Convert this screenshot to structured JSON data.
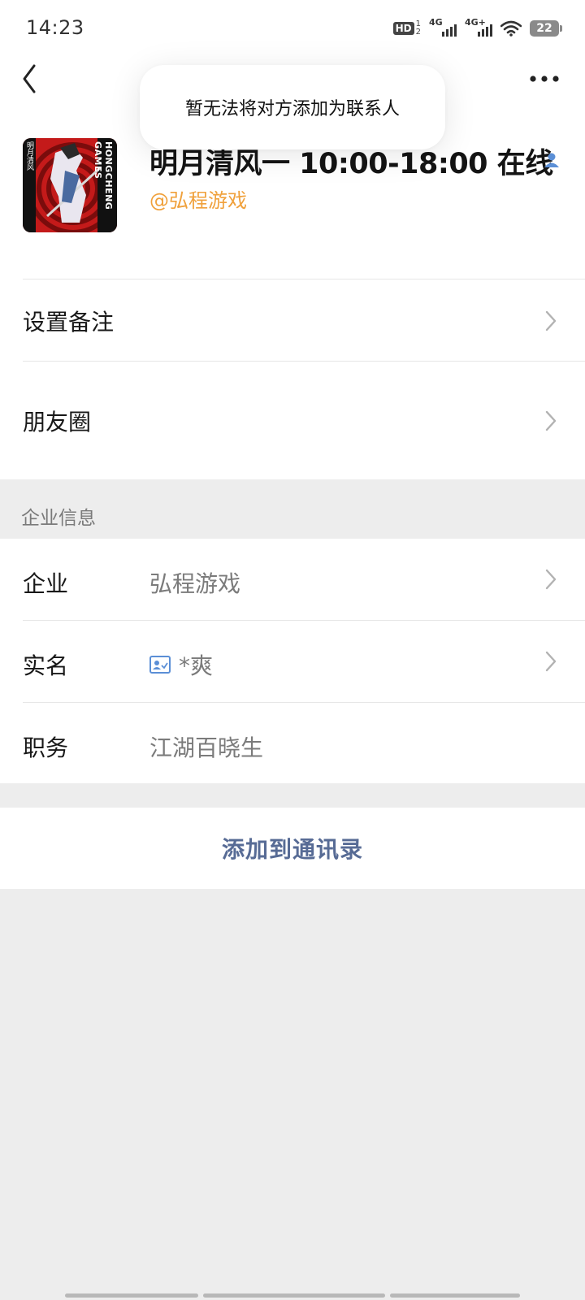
{
  "status_bar": {
    "time": "14:23",
    "hd_label": "HD",
    "hd_sup": "1",
    "hd_sub": "2",
    "signal1_label": "4G",
    "signal2_label": "4G+",
    "battery": "22",
    "icons": [
      "hd-voice-icon",
      "signal-icon",
      "signal-icon",
      "wifi-icon",
      "battery-icon"
    ]
  },
  "nav": {
    "back_icon": "chevron-left-icon",
    "more_icon": "more-dots-icon"
  },
  "toast": {
    "message": "暂无法将对方添加为联系人"
  },
  "profile": {
    "name": "明月清风一 10:00-18:00 在线",
    "company": "@弘程游戏",
    "avatar_text": "HONGCHENG GAMES",
    "avatar_side_text": "明月清风",
    "verified_icon": "person-icon",
    "company_color": "#f0a13c"
  },
  "menu": {
    "items": [
      {
        "label": "设置备注"
      },
      {
        "label": "朋友圈"
      }
    ]
  },
  "enterprise": {
    "section_title": "企业信息",
    "rows": [
      {
        "key": "企业",
        "value": "弘程游戏",
        "has_chevron": true
      },
      {
        "key": "实名",
        "value": "*爽",
        "has_chevron": true,
        "icon": "id-card-icon"
      },
      {
        "key": "职务",
        "value": "江湖百晓生",
        "has_chevron": false
      }
    ]
  },
  "actions": {
    "add_to_contacts": "添加到通讯录",
    "link_color": "#576b95"
  }
}
